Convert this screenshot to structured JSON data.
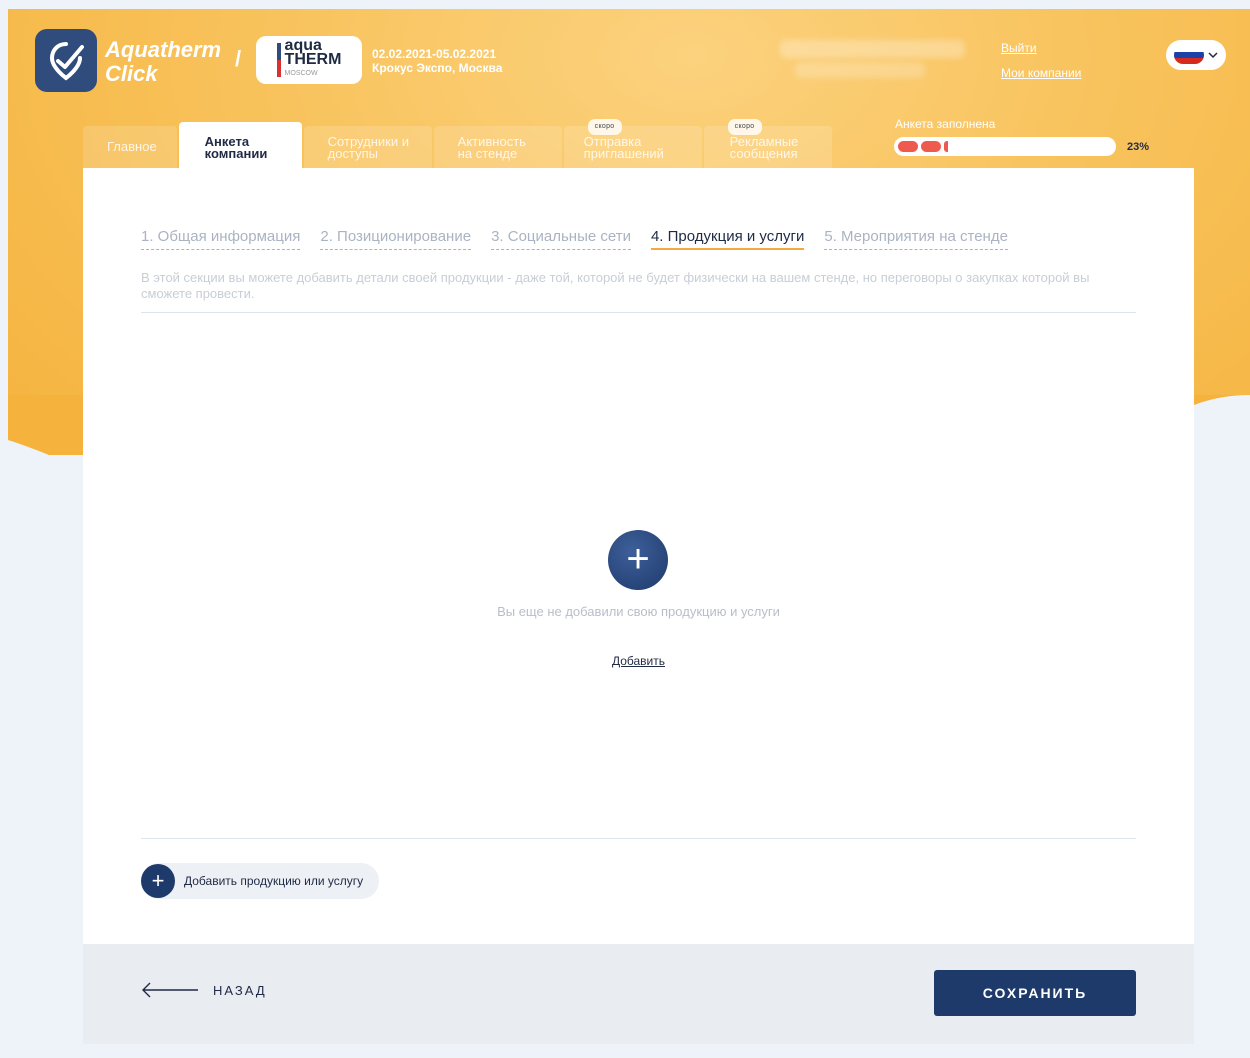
{
  "header": {
    "brand_line1": "Aquatherm",
    "brand_line2": "Click",
    "partner_line1": "aqua",
    "partner_line2": "THERM",
    "partner_line3": "MOSCOW",
    "event_dates": "02.02.2021-05.02.2021",
    "event_place": "Крокус Экспо, Москва",
    "logout_label": "Выйти",
    "my_companies_label": "Мои компании"
  },
  "tabs": [
    {
      "label": "Главное",
      "soon": ""
    },
    {
      "label": "Анкета компании",
      "soon": ""
    },
    {
      "label": "Сотрудники и доступы",
      "soon": ""
    },
    {
      "label": "Активность на стенде",
      "soon": ""
    },
    {
      "label": "Отправка приглашений",
      "soon": "скоро"
    },
    {
      "label": "Рекламные сообщения",
      "soon": "скоро"
    }
  ],
  "progress": {
    "label": "Анкета заполнена",
    "percent_text": "23%",
    "percent": 23
  },
  "steps": [
    "1. Общая информация",
    "2. Позиционирование",
    "3. Социальные сети",
    "4. Продукция и услуги",
    "5. Мероприятия на стенде"
  ],
  "section": {
    "description": "В этой секции вы можете добавить детали своей продукции - даже той, которой не будет физически на вашем стенде, но переговоры о закупках которой вы сможете провести.",
    "empty_text": "Вы еще не добавили свою продукцию и услуги",
    "add_link": "Добавить",
    "add_product_label": "Добавить продукцию или услугу"
  },
  "footer": {
    "back_label": "НАЗАД",
    "save_label": "СОХРАНИТЬ"
  },
  "colors": {
    "accent": "#1e3a6b",
    "orange": "#f5b23c",
    "progress": "#ef5a4f"
  },
  "icons": [
    "app-logo-icon",
    "flag-ru-icon",
    "chevron-down-icon",
    "plus-icon",
    "arrow-left-icon"
  ]
}
